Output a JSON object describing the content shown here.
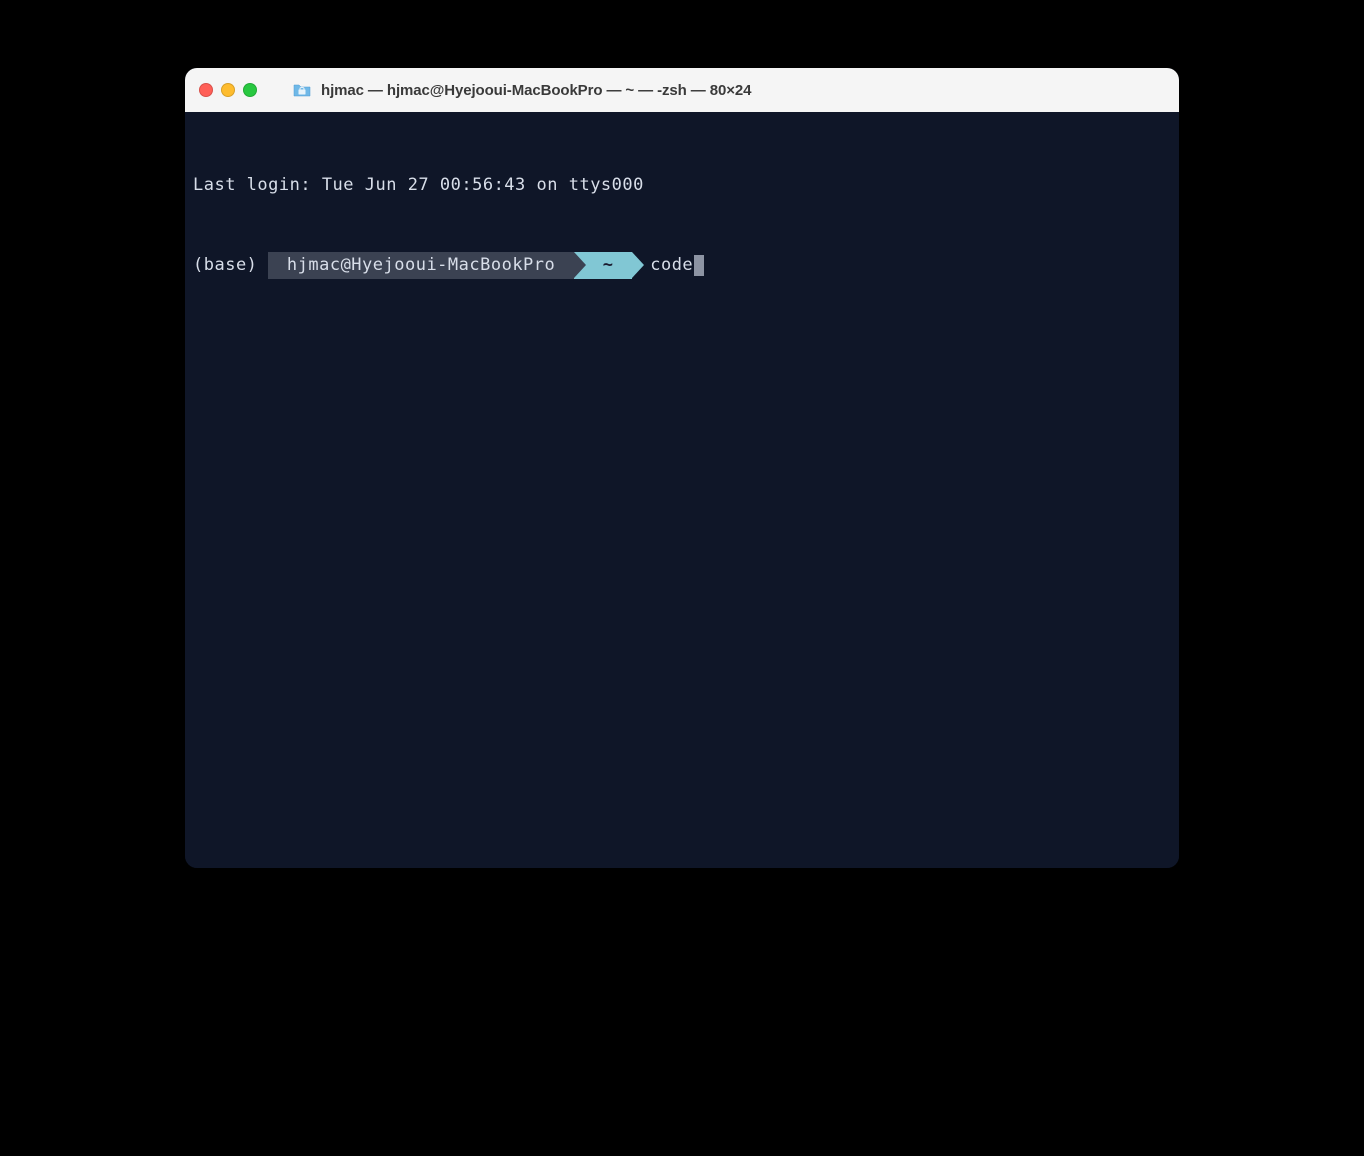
{
  "window": {
    "title": "hjmac — hjmac@Hyejooui-MacBookPro — ~ — -zsh — 80×24"
  },
  "terminal": {
    "login_line": "Last login: Tue Jun 27 00:56:43 on ttys000",
    "base_prefix": "(base) ",
    "hostname_segment": " hjmac@Hyejooui-MacBookPro ",
    "path_segment": " ~ ",
    "command": "code"
  },
  "colors": {
    "window_bg": "#0f1628",
    "titlebar_bg": "#f5f5f5",
    "text": "#d8dee9",
    "segment_dark": "#3b4252",
    "segment_cyan": "#81c7d4"
  }
}
